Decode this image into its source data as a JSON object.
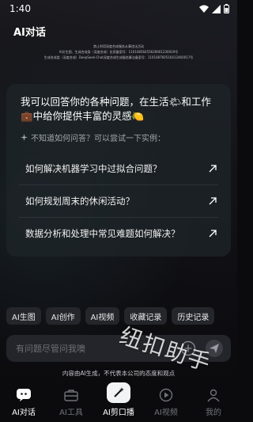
{
  "status": {
    "time": "1:40"
  },
  "app": {
    "title": "AI对话"
  },
  "notice": {
    "lines": [
      "禁止利用深度合成服务从事违法活动",
      "AI文生图、生成合成类（深度合成）应用备案号：11010856455626901230019号",
      "生成合成类（深度合成）DeepSeek-Chat深度合成生成服务算法备案号：110108760516412460017号"
    ]
  },
  "card": {
    "intro_part1": "我可以回答你的各种问题，在生活",
    "intro_emoji1": "🌤",
    "intro_part2": "和工作",
    "intro_emoji2": "💼",
    "intro_part3": "中给你提供丰富的灵感",
    "intro_emoji3": "🍋",
    "hint": "不知道如何问答？可以尝试一下实例：",
    "questions": [
      "如何解决机器学习中过拟合问题？",
      "如何规划周末的休闲活动？",
      "数据分析和处理中常见难题如何解决？"
    ]
  },
  "chips": [
    "AI生图",
    "AI创作",
    "AI视频",
    "收藏记录",
    "历史记录"
  ],
  "input": {
    "placeholder": "有问题尽管问我噢"
  },
  "disclaimer": "内容由AI生成，不代表本公司的态度和观点",
  "tabs": [
    {
      "label": "AI对话",
      "icon": "chat-icon",
      "active": true
    },
    {
      "label": "AI工具",
      "icon": "toolbox-icon",
      "active": false
    },
    {
      "label": "AI剪口播",
      "icon": "magic-wand-icon",
      "active": false
    },
    {
      "label": "AI视频",
      "icon": "play-icon",
      "active": false
    },
    {
      "label": "我的",
      "icon": "profile-icon",
      "active": false
    }
  ],
  "watermark": "纽扣助手",
  "colors": {
    "background": "#0b0b0e",
    "card": "#1e2428",
    "chip": "#24262b",
    "accent": "#ffffff"
  }
}
